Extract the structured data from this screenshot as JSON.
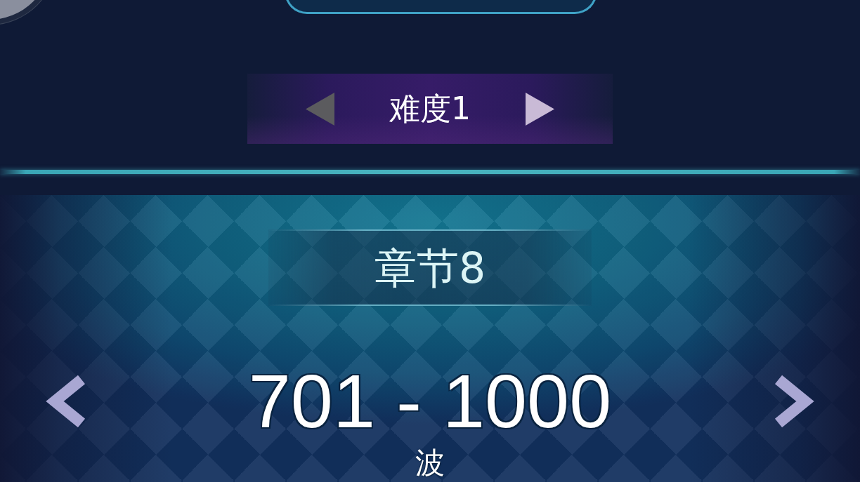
{
  "difficulty": {
    "label": "难度1",
    "prev": {
      "disabled": true
    },
    "next": {
      "disabled": false
    }
  },
  "chapter": {
    "title": "章节8"
  },
  "wave_range": {
    "range": "701 - 1000",
    "unit": "波"
  }
}
